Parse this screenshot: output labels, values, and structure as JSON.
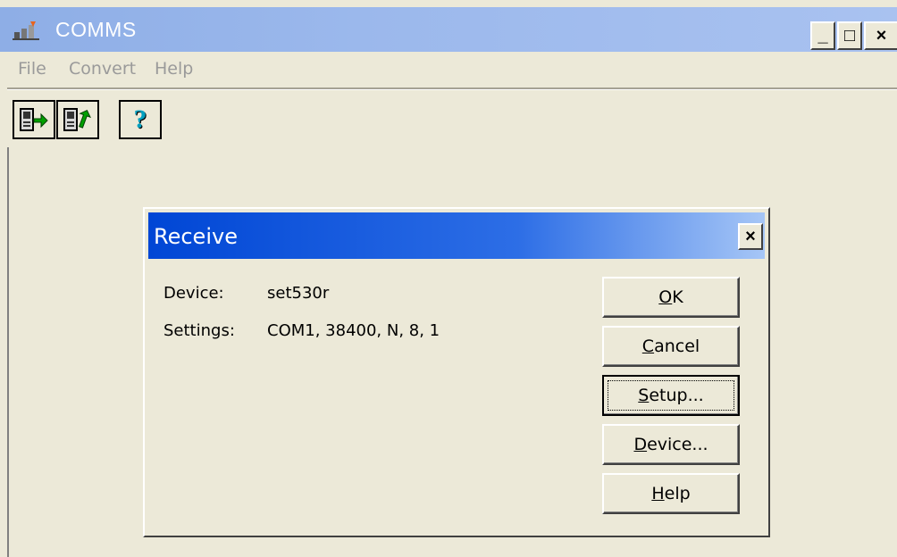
{
  "window": {
    "title": "COMMS",
    "controls": {
      "minimize": "_",
      "maximize": "□",
      "close": "×"
    }
  },
  "menu": {
    "items": [
      "File",
      "Convert",
      "Help"
    ]
  },
  "toolbar": {
    "buttons": [
      {
        "name": "receive",
        "icon": "receive-icon"
      },
      {
        "name": "send",
        "icon": "send-icon"
      },
      {
        "name": "help",
        "icon": "question-icon",
        "glyph": "?"
      }
    ]
  },
  "dialog": {
    "title": "Receive",
    "close_glyph": "×",
    "fields": [
      {
        "label": "Device:",
        "value": "set530r"
      },
      {
        "label": "Settings:",
        "value": "COM1, 38400, N, 8, 1"
      }
    ],
    "buttons": {
      "ok": {
        "mnemonic": "O",
        "rest": "K"
      },
      "cancel": {
        "mnemonic": "C",
        "rest": "ancel"
      },
      "setup": {
        "mnemonic": "S",
        "rest": "etup..."
      },
      "device": {
        "mnemonic": "D",
        "rest": "evice..."
      },
      "help": {
        "mnemonic": "H",
        "rest": "elp"
      }
    }
  },
  "colors": {
    "app_titlebar": "#9bb8ec",
    "dialog_titlebar": "#0046d5",
    "face": "#ece9d8",
    "menu_disabled_text": "#9a9a9a",
    "help_icon": "#00a0c0",
    "arrow_green": "#00a000"
  }
}
